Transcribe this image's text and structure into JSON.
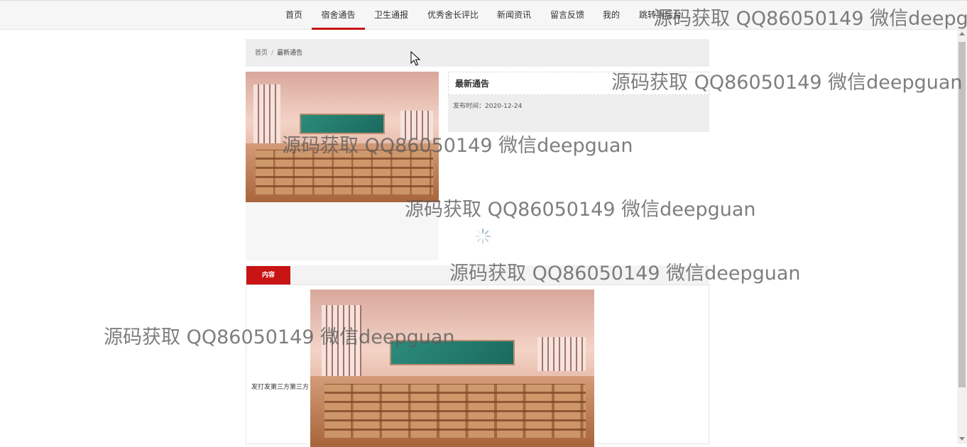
{
  "nav": {
    "items": [
      {
        "label": "首页"
      },
      {
        "label": "宿舍通告"
      },
      {
        "label": "卫生通报"
      },
      {
        "label": "优秀舍长评比"
      },
      {
        "label": "新闻资讯"
      },
      {
        "label": "留言反馈"
      },
      {
        "label": "我的"
      },
      {
        "label": "跳转到后台"
      }
    ],
    "active_index": 1
  },
  "breadcrumb": {
    "home": "首页",
    "separator": "/",
    "current": "最新通告"
  },
  "notice": {
    "title": "最新通告",
    "published_label": "发布时间：",
    "published_date": "2020-12-24"
  },
  "content": {
    "tab_label": "内容",
    "text": "发打发第三方第三方"
  },
  "watermark": {
    "text": "源码获取 QQ86050149 微信deepguan"
  },
  "colors": {
    "accent": "#c81414",
    "nav_bg": "#f6f6f6",
    "panel_bg": "#eeeeee"
  },
  "icons": {
    "cursor": "arrow-cursor-icon",
    "loading": "loading-spinner-icon"
  }
}
